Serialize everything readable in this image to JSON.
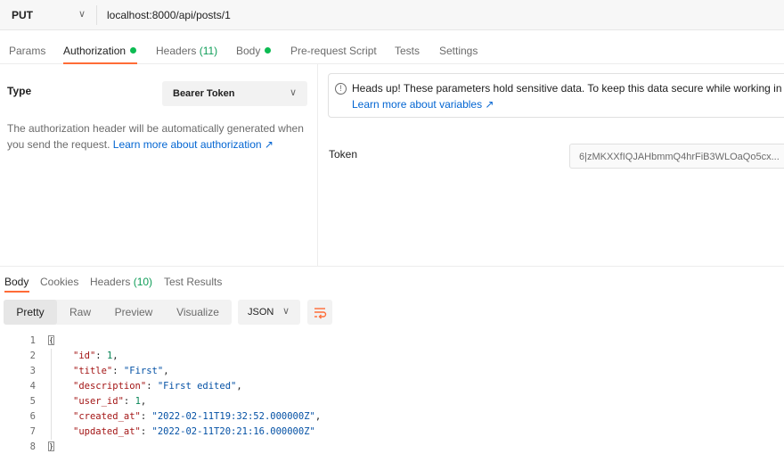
{
  "request": {
    "method": "PUT",
    "url": "localhost:8000/api/posts/1"
  },
  "request_tabs": [
    {
      "label": "Params"
    },
    {
      "label": "Authorization"
    },
    {
      "label": "Headers",
      "count": "(11)"
    },
    {
      "label": "Body"
    },
    {
      "label": "Pre-request Script"
    },
    {
      "label": "Tests"
    },
    {
      "label": "Settings"
    }
  ],
  "auth": {
    "type_label": "Type",
    "type_value": "Bearer Token",
    "description": "The authorization header will be automatically generated when you send the request.",
    "description_link": "Learn more about authorization ↗",
    "notice": "Heads up! These parameters hold sensitive data. To keep this data secure while working in a c",
    "notice_link": "Learn more about variables ↗",
    "token_label": "Token",
    "token_value": "6|zMKXXfIQJAHbmmQ4hrFiB3WLOaQo5cx..."
  },
  "response_tabs": [
    {
      "label": "Body"
    },
    {
      "label": "Cookies"
    },
    {
      "label": "Headers",
      "count": "(10)"
    },
    {
      "label": "Test Results"
    }
  ],
  "view_modes": [
    "Pretty",
    "Raw",
    "Preview",
    "Visualize"
  ],
  "format": "JSON",
  "code_lines": [
    {
      "n": "1"
    },
    {
      "n": "2",
      "key": "\"id\"",
      "val": "1",
      "type": "num",
      "comma": ","
    },
    {
      "n": "3",
      "key": "\"title\"",
      "val": "\"First\"",
      "type": "str",
      "comma": ","
    },
    {
      "n": "4",
      "key": "\"description\"",
      "val": "\"First edited\"",
      "type": "str",
      "comma": ","
    },
    {
      "n": "5",
      "key": "\"user_id\"",
      "val": "1",
      "type": "num",
      "comma": ","
    },
    {
      "n": "6",
      "key": "\"created_at\"",
      "val": "\"2022-02-11T19:32:52.000000Z\"",
      "type": "str",
      "comma": ","
    },
    {
      "n": "7",
      "key": "\"updated_at\"",
      "val": "\"2022-02-11T20:21:16.000000Z\"",
      "type": "str",
      "comma": ""
    },
    {
      "n": "8"
    }
  ],
  "colors": {
    "accent": "#ff6c37",
    "status_dot": "#0cbb52",
    "link": "#0265d2"
  },
  "icons": [
    "chevron-down-icon",
    "info-icon",
    "wrap-lines-icon",
    "brace-icon"
  ]
}
